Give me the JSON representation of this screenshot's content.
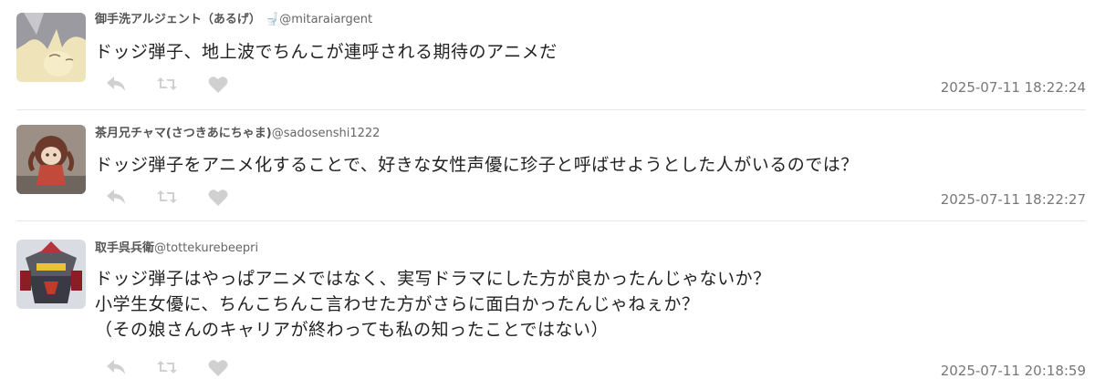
{
  "tweets": [
    {
      "display_name": "御手洗アルジェント（あるげ）",
      "emoji": "🚽",
      "handle": "@mitaraiargent",
      "lines": [
        "ドッジ弾子、地上波でちんこが連呼される期待のアニメだ"
      ],
      "timestamp": "2025-07-11 18:22:24",
      "icons": [
        "reply-icon",
        "retweet-icon",
        "like-icon"
      ]
    },
    {
      "display_name": "茶月兄チャマ(さつきあにちゃま)",
      "handle": "@sadosenshi1222",
      "lines": [
        "ドッジ弾子をアニメ化することで、好きな女性声優に珍子と呼ばせようとした人がいるのでは？"
      ],
      "timestamp": "2025-07-11 18:22:27",
      "icons": [
        "reply-icon",
        "retweet-icon",
        "like-icon"
      ]
    },
    {
      "display_name": "取手呉兵衛",
      "handle": "@tottekurebeepri",
      "lines": [
        "ドッジ弾子はやっぱアニメではなく、実写ドラマにした方が良かったんじゃないか？",
        "小学生女優に、ちんこちんこ言わせた方がさらに面白かったんじゃねぇか？",
        "（その娘さんのキャリアが終わっても私の知ったことではない）"
      ],
      "timestamp": "2025-07-11 20:18:59",
      "icons": [
        "reply-icon",
        "retweet-icon",
        "like-icon"
      ]
    }
  ],
  "colors": {
    "icon": "#d0d0d0",
    "divider": "#e6e6e6",
    "text": "#222222",
    "meta": "#777777"
  }
}
